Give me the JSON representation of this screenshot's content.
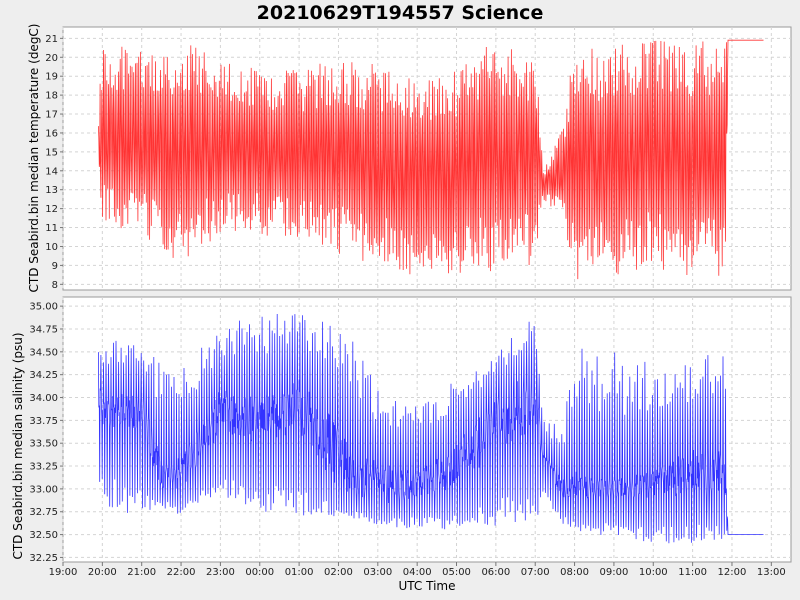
{
  "title": "20210629T194557 Science",
  "chart_data": [
    {
      "type": "line",
      "ylabel": "CTD Seabird.bin median temperature (degC)",
      "ylim": [
        7.7,
        21.6
      ],
      "yticks": [
        "8",
        "9",
        "10",
        "11",
        "12",
        "13",
        "14",
        "15",
        "16",
        "17",
        "18",
        "19",
        "20",
        "21"
      ],
      "series": [
        {
          "color": "#ff3333",
          "style": "oscillating-profiles",
          "x": [
            19.9,
            19.95,
            20.0,
            21.0,
            22.0,
            23.0,
            24.0,
            25.0,
            26.0,
            27.0,
            28.0,
            29.0,
            30.0,
            31.0,
            31.2,
            31.7,
            32.0,
            33.0,
            34.0,
            35.0,
            35.85,
            35.9,
            36.8
          ],
          "y_max": [
            16.4,
            19.0,
            21.1,
            20.3,
            21.1,
            19.8,
            19.5,
            19.3,
            20.0,
            19.8,
            19.2,
            19.6,
            21.0,
            20.5,
            14.0,
            16.5,
            20.6,
            20.8,
            21.0,
            21.0,
            20.8,
            20.9,
            20.9
          ],
          "y_min": [
            14.8,
            11.0,
            10.7,
            10.6,
            9.0,
            10.7,
            10.6,
            10.3,
            9.6,
            9.0,
            8.4,
            8.6,
            8.6,
            9.0,
            12.5,
            11.5,
            8.2,
            8.4,
            8.8,
            8.4,
            8.3,
            20.9,
            20.9
          ]
        }
      ]
    },
    {
      "type": "line",
      "ylabel": "CTD Seabird.bin median salinity (psu)",
      "ylim": [
        32.2,
        35.1
      ],
      "yticks": [
        "32.25",
        "32.50",
        "32.75",
        "33.00",
        "33.25",
        "33.50",
        "33.75",
        "34.00",
        "34.25",
        "34.50",
        "34.75",
        "35.00"
      ],
      "series": [
        {
          "color": "#3333ff",
          "style": "oscillating-profiles",
          "x": [
            19.9,
            20.0,
            21.0,
            21.5,
            22.0,
            23.0,
            24.0,
            25.0,
            26.0,
            26.5,
            27.0,
            28.0,
            29.0,
            30.0,
            31.0,
            31.2,
            31.7,
            32.0,
            33.0,
            34.0,
            35.0,
            35.85,
            35.9,
            36.8
          ],
          "y_max": [
            34.75,
            34.7,
            34.6,
            34.4,
            34.3,
            34.8,
            34.9,
            34.95,
            34.8,
            34.6,
            34.1,
            33.9,
            34.2,
            34.5,
            34.9,
            33.8,
            33.7,
            34.6,
            34.5,
            34.4,
            34.4,
            34.6,
            32.5,
            32.5
          ],
          "y_min": [
            32.85,
            32.8,
            32.7,
            32.8,
            32.7,
            32.8,
            32.75,
            32.7,
            32.7,
            32.65,
            32.6,
            32.55,
            32.55,
            32.6,
            32.6,
            32.9,
            32.6,
            32.5,
            32.45,
            32.4,
            32.4,
            32.45,
            32.5,
            32.5
          ],
          "y_center_max": [
            34.2,
            34.0,
            34.1,
            33.3,
            33.4,
            34.1,
            34.0,
            34.2,
            33.7,
            33.4,
            33.3,
            33.2,
            33.5,
            34.0,
            34.4,
            33.4,
            33.1,
            33.2,
            33.1,
            33.2,
            33.5,
            33.4,
            32.5,
            32.5
          ],
          "y_center_min": [
            33.9,
            33.7,
            33.6,
            33.0,
            33.0,
            33.6,
            33.5,
            33.6,
            33.0,
            32.9,
            32.8,
            32.9,
            33.0,
            33.4,
            33.6,
            33.3,
            32.9,
            32.9,
            32.9,
            32.9,
            32.95,
            32.9,
            32.5,
            32.5
          ]
        }
      ]
    }
  ],
  "x_axis": {
    "label": "UTC Time",
    "range": [
      19,
      37.5
    ],
    "ticks": [
      {
        "value": 19,
        "label": "19:00"
      },
      {
        "value": 20,
        "label": "20:00"
      },
      {
        "value": 21,
        "label": "21:00"
      },
      {
        "value": 22,
        "label": "22:00"
      },
      {
        "value": 23,
        "label": "23:00"
      },
      {
        "value": 24,
        "label": "00:00"
      },
      {
        "value": 25,
        "label": "01:00"
      },
      {
        "value": 26,
        "label": "02:00"
      },
      {
        "value": 27,
        "label": "03:00"
      },
      {
        "value": 28,
        "label": "04:00"
      },
      {
        "value": 29,
        "label": "05:00"
      },
      {
        "value": 30,
        "label": "06:00"
      },
      {
        "value": 31,
        "label": "07:00"
      },
      {
        "value": 32,
        "label": "08:00"
      },
      {
        "value": 33,
        "label": "09:00"
      },
      {
        "value": 34,
        "label": "10:00"
      },
      {
        "value": 35,
        "label": "11:00"
      },
      {
        "value": 36,
        "label": "12:00"
      },
      {
        "value": 37,
        "label": "13:00"
      }
    ]
  }
}
